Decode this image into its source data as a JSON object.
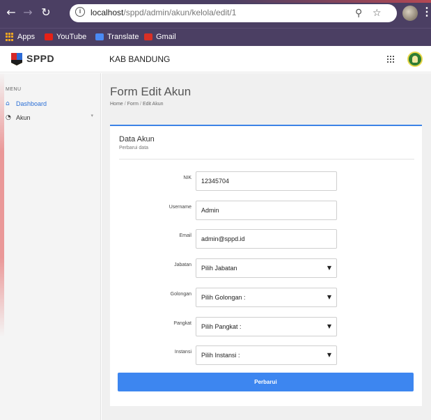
{
  "browser": {
    "url_host": "localhost",
    "url_path": "/sppd/admin/akun/kelola/edit/1",
    "bookmarks": [
      {
        "label": "Apps",
        "icon": "apps-icon"
      },
      {
        "label": "YouTube",
        "icon": "youtube-icon"
      },
      {
        "label": "Translate",
        "icon": "translate-icon"
      },
      {
        "label": "Gmail",
        "icon": "gmail-icon"
      }
    ]
  },
  "header": {
    "logo_text": "SPPD",
    "title": "KAB BANDUNG"
  },
  "sidebar": {
    "heading": "MENU",
    "items": [
      {
        "label": "Dashboard",
        "icon": "home-icon",
        "active": true
      },
      {
        "label": "Akun",
        "icon": "user-circle-icon",
        "active": false
      }
    ]
  },
  "main": {
    "page_title": "Form Edit Akun",
    "breadcrumb": [
      "Home",
      "Form",
      "Edit Akun"
    ],
    "card": {
      "title": "Data Akun",
      "subtitle": "Perbarui data",
      "fields": {
        "nik": {
          "label": "NIK",
          "value": "12345704"
        },
        "username": {
          "label": "Username",
          "value": "Admin"
        },
        "email": {
          "label": "Email",
          "value": "admin@sppd.id"
        },
        "jabatan": {
          "label": "Jabatan",
          "selected": "Pilih Jabatan"
        },
        "golongan": {
          "label": "Golongan",
          "selected": "Pilih Golongan :"
        },
        "pangkat": {
          "label": "Pangkat",
          "selected": "Pilih Pangkat :"
        },
        "instansi": {
          "label": "Instansi",
          "selected": "Pilih Instansi :"
        }
      },
      "submit_label": "Perbarui"
    }
  },
  "colors": {
    "chrome": "#4b3f63",
    "accent_blue": "#3b82e6",
    "button_blue": "#3d86f0",
    "active_link": "#2b6fd6"
  }
}
